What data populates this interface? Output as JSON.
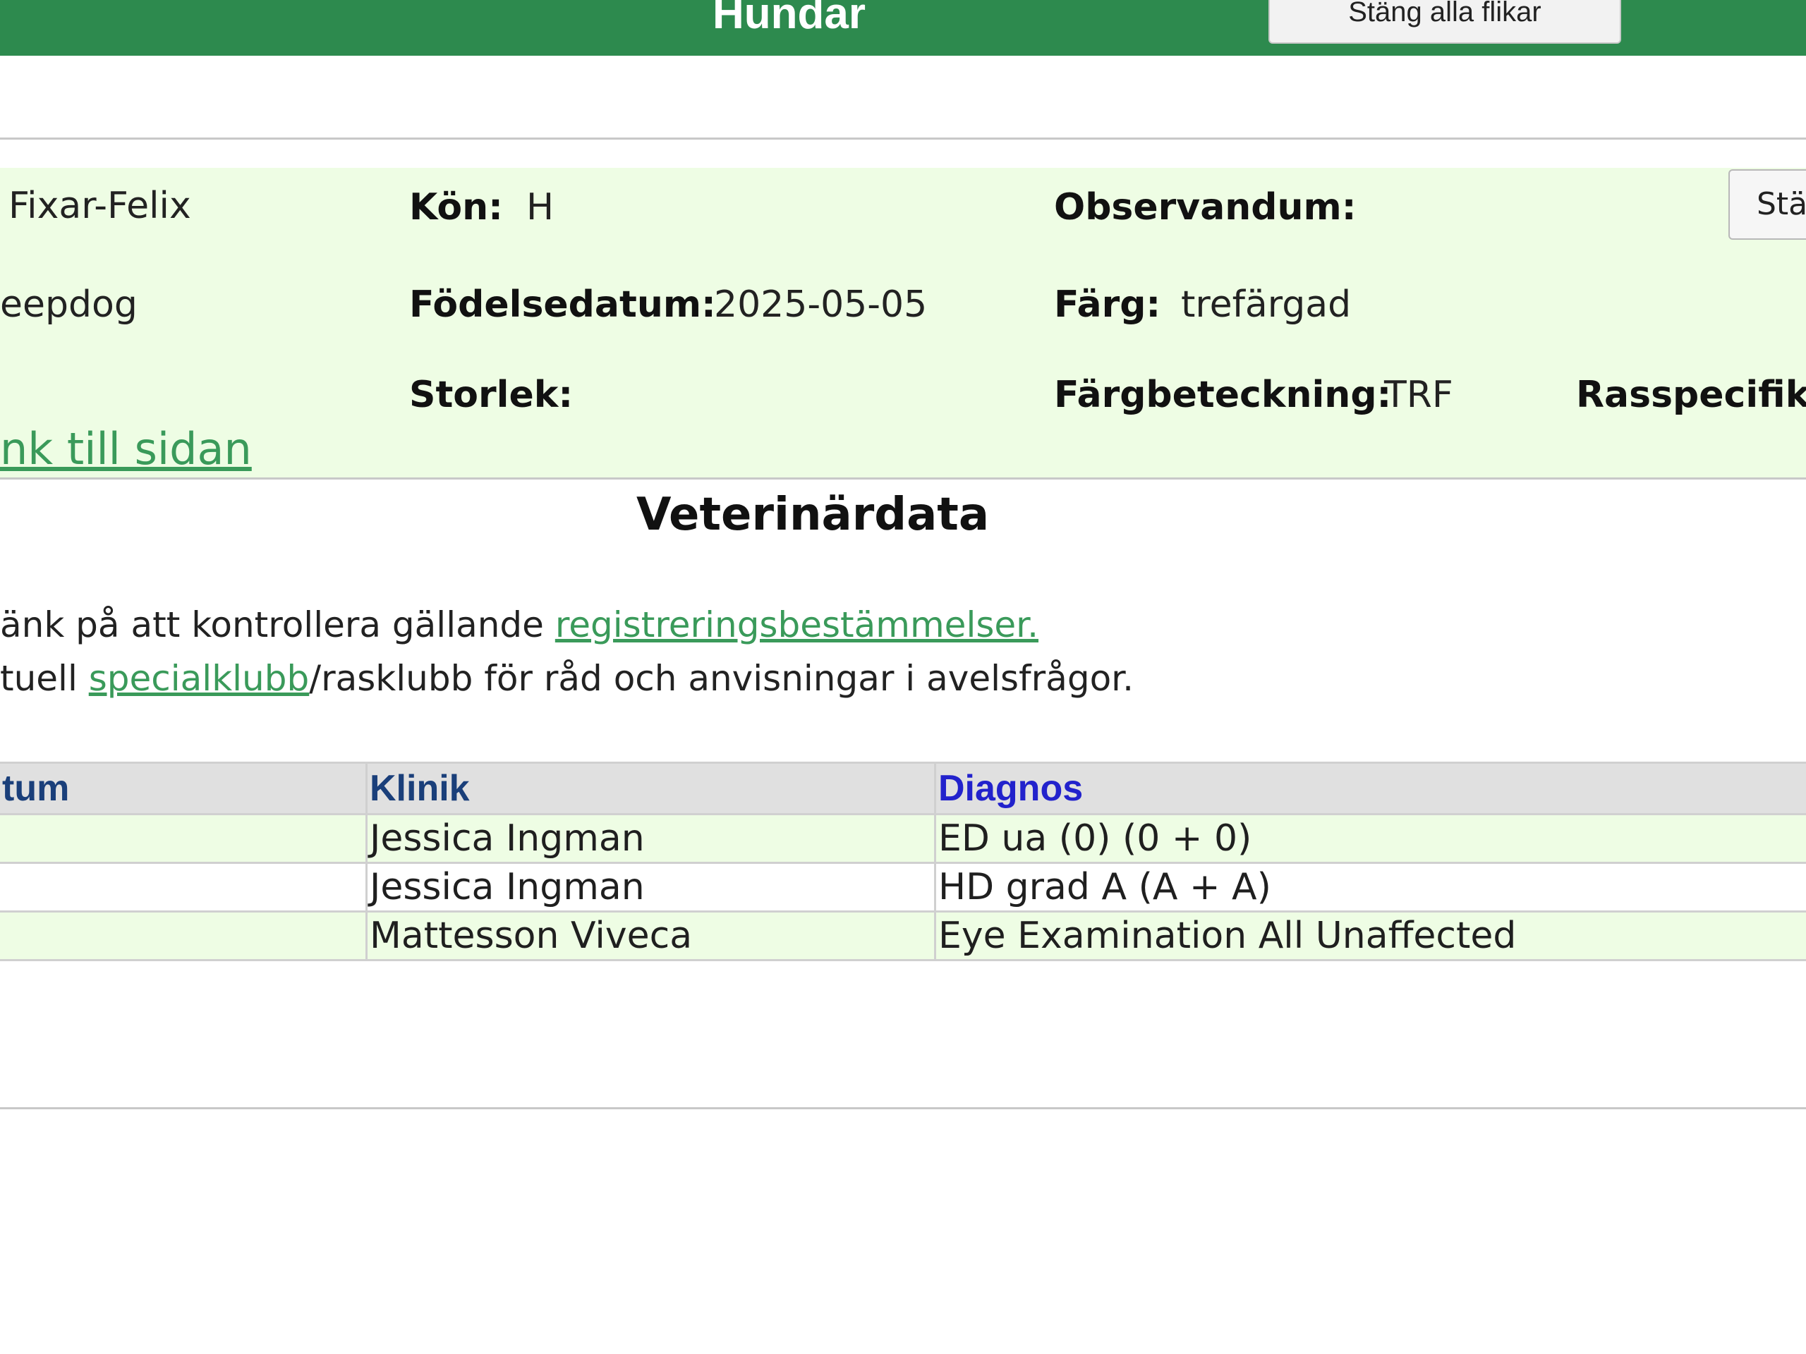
{
  "header": {
    "title": "Hundar",
    "close_tabs_label": "Stäng alla flikar"
  },
  "dog": {
    "name": "Fixar-Felix",
    "breed_fragment": "eepdog",
    "gender_label": "Kön:",
    "gender_value": "H",
    "birthdate_label": "Födelsedatum:",
    "birthdate_value": "2025-05-05",
    "size_label": "Storlek:",
    "size_value": "",
    "observandum_label": "Observandum:",
    "color_label": "Färg:",
    "color_value": "trefärgad",
    "color_code_label": "Färgbeteckning:",
    "color_code_value": "TRF",
    "breed_specific_label": "Rasspecifikt:",
    "page_link": "nk till sidan",
    "side_button_label": "Stä"
  },
  "vet": {
    "title": "Veterinärdata",
    "notice_line1_prefix": "änk på att kontrollera gällande ",
    "notice_line1_link": "registreringsbestämmelser.",
    "notice_line2_prefix": "tuell ",
    "notice_line2_link": "specialklubb",
    "notice_line2_suffix": "/rasklubb för råd och anvisningar i avelsfrågor.",
    "columns": {
      "datum": "tum",
      "klinik": "Klinik",
      "diagnos": "Diagnos"
    },
    "rows": [
      {
        "datum": "",
        "klinik": "Jessica Ingman",
        "diagnos": "ED ua (0) (0 + 0)"
      },
      {
        "datum": "",
        "klinik": "Jessica Ingman",
        "diagnos": "HD grad A (A + A)"
      },
      {
        "datum": "",
        "klinik": "Mattesson Viveca",
        "diagnos": "Eye Examination All Unaffected"
      }
    ]
  }
}
